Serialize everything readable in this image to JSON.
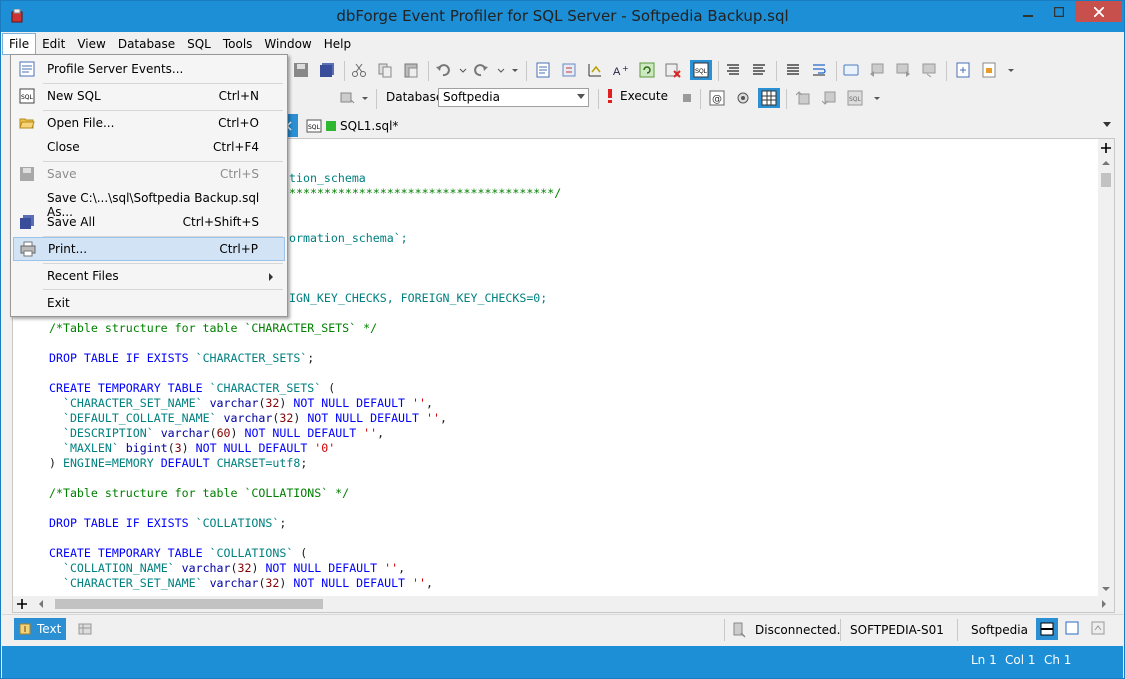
{
  "window": {
    "title": "dbForge Event Profiler for SQL Server - Softpedia Backup.sql"
  },
  "menubar": {
    "items": [
      "File",
      "Edit",
      "View",
      "Database",
      "SQL",
      "Tools",
      "Window",
      "Help"
    ]
  },
  "file_menu": {
    "items": [
      {
        "label": "Profile Server Events...",
        "shortcut": "",
        "icon": "profile-events-icon",
        "disabled": false
      },
      {
        "label": "New SQL",
        "shortcut": "Ctrl+N",
        "icon": "new-sql-icon",
        "disabled": false
      },
      {
        "label": "Open File...",
        "shortcut": "Ctrl+O",
        "icon": "open-folder-icon",
        "disabled": false
      },
      {
        "label": "Close",
        "shortcut": "Ctrl+F4",
        "icon": "",
        "disabled": false
      },
      {
        "label": "Save",
        "shortcut": "Ctrl+S",
        "icon": "save-icon",
        "disabled": true
      },
      {
        "label": "Save C:\\...\\sql\\Softpedia Backup.sql As...",
        "shortcut": "",
        "icon": "",
        "disabled": false
      },
      {
        "label": "Save All",
        "shortcut": "Ctrl+Shift+S",
        "icon": "save-all-icon",
        "disabled": false
      },
      {
        "label": "Print...",
        "shortcut": "Ctrl+P",
        "icon": "printer-icon",
        "disabled": false
      },
      {
        "label": "Recent Files",
        "shortcut": "",
        "icon": "",
        "disabled": false
      },
      {
        "label": "Exit",
        "shortcut": "",
        "icon": "",
        "disabled": false
      }
    ]
  },
  "toolbar": {
    "database_label": "Database",
    "database_value": "Softpedia",
    "execute_label": "Execute"
  },
  "tabs": {
    "document": "SQL1.sql*"
  },
  "editor": {
    "lines_partial": [
      "tion_schema",
      "**************************************/",
      "ormation_schema`;",
      "IGN_KEY_CHECKS, FOREIGN_KEY_CHECKS=0;"
    ]
  },
  "bottom": {
    "text_tab": "Text",
    "connection": "Disconnected.",
    "server": "SOFTPEDIA-S01",
    "database": "Softpedia"
  },
  "status": {
    "ln": "Ln 1",
    "col": "Col 1",
    "ch": "Ch 1"
  },
  "colors": {
    "accent": "#1c8fd6",
    "keyword": "#0000ff",
    "comment": "#008000",
    "string": "#d00000"
  }
}
